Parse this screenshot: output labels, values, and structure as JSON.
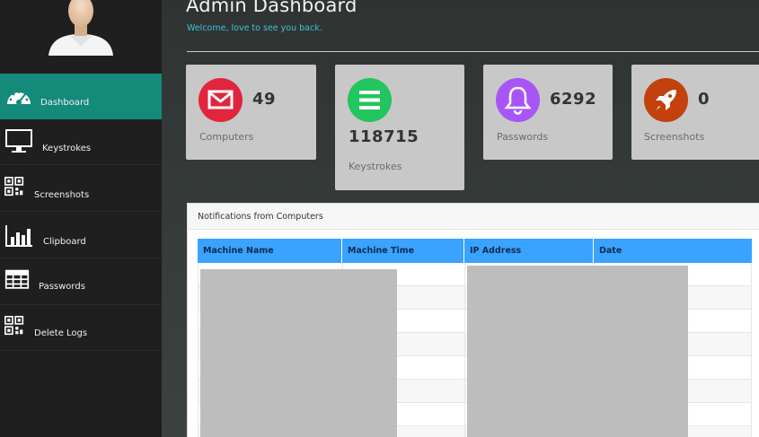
{
  "sidebar": {
    "items": [
      {
        "label": "Dashboard",
        "icon": "dashboard-gauge-icon",
        "active": true
      },
      {
        "label": "Keystrokes",
        "icon": "monitor-icon",
        "active": false
      },
      {
        "label": "Screenshots",
        "icon": "qr-code-icon",
        "active": false
      },
      {
        "label": "Clipboard",
        "icon": "bar-chart-icon",
        "active": false
      },
      {
        "label": "Passwords",
        "icon": "table-icon",
        "active": false
      },
      {
        "label": "Delete Logs",
        "icon": "qr-code-icon",
        "active": false
      }
    ]
  },
  "header": {
    "title": "Admin Dashboard",
    "subtitle": "Welcome, love to see you back."
  },
  "cards": [
    {
      "count": "49",
      "label": "Computers",
      "icon": "envelope-icon",
      "color": "#e0253d"
    },
    {
      "count": "118715",
      "label": "Keystrokes",
      "icon": "list-icon",
      "color": "#22c55e"
    },
    {
      "count": "6292",
      "label": "Passwords",
      "icon": "bell-icon",
      "color": "#a855f7"
    },
    {
      "count": "0",
      "label": "Screenshots",
      "icon": "rocket-icon",
      "color": "#c2410c"
    }
  ],
  "notifications": {
    "title": "Notifications from Computers",
    "columns": [
      "Machine Name",
      "Machine Time",
      "IP Address",
      "Date"
    ]
  },
  "colors": {
    "sidebar_active": "#138a7a",
    "accent_text": "#3fc3d6",
    "table_header": "#3aa2ff"
  }
}
